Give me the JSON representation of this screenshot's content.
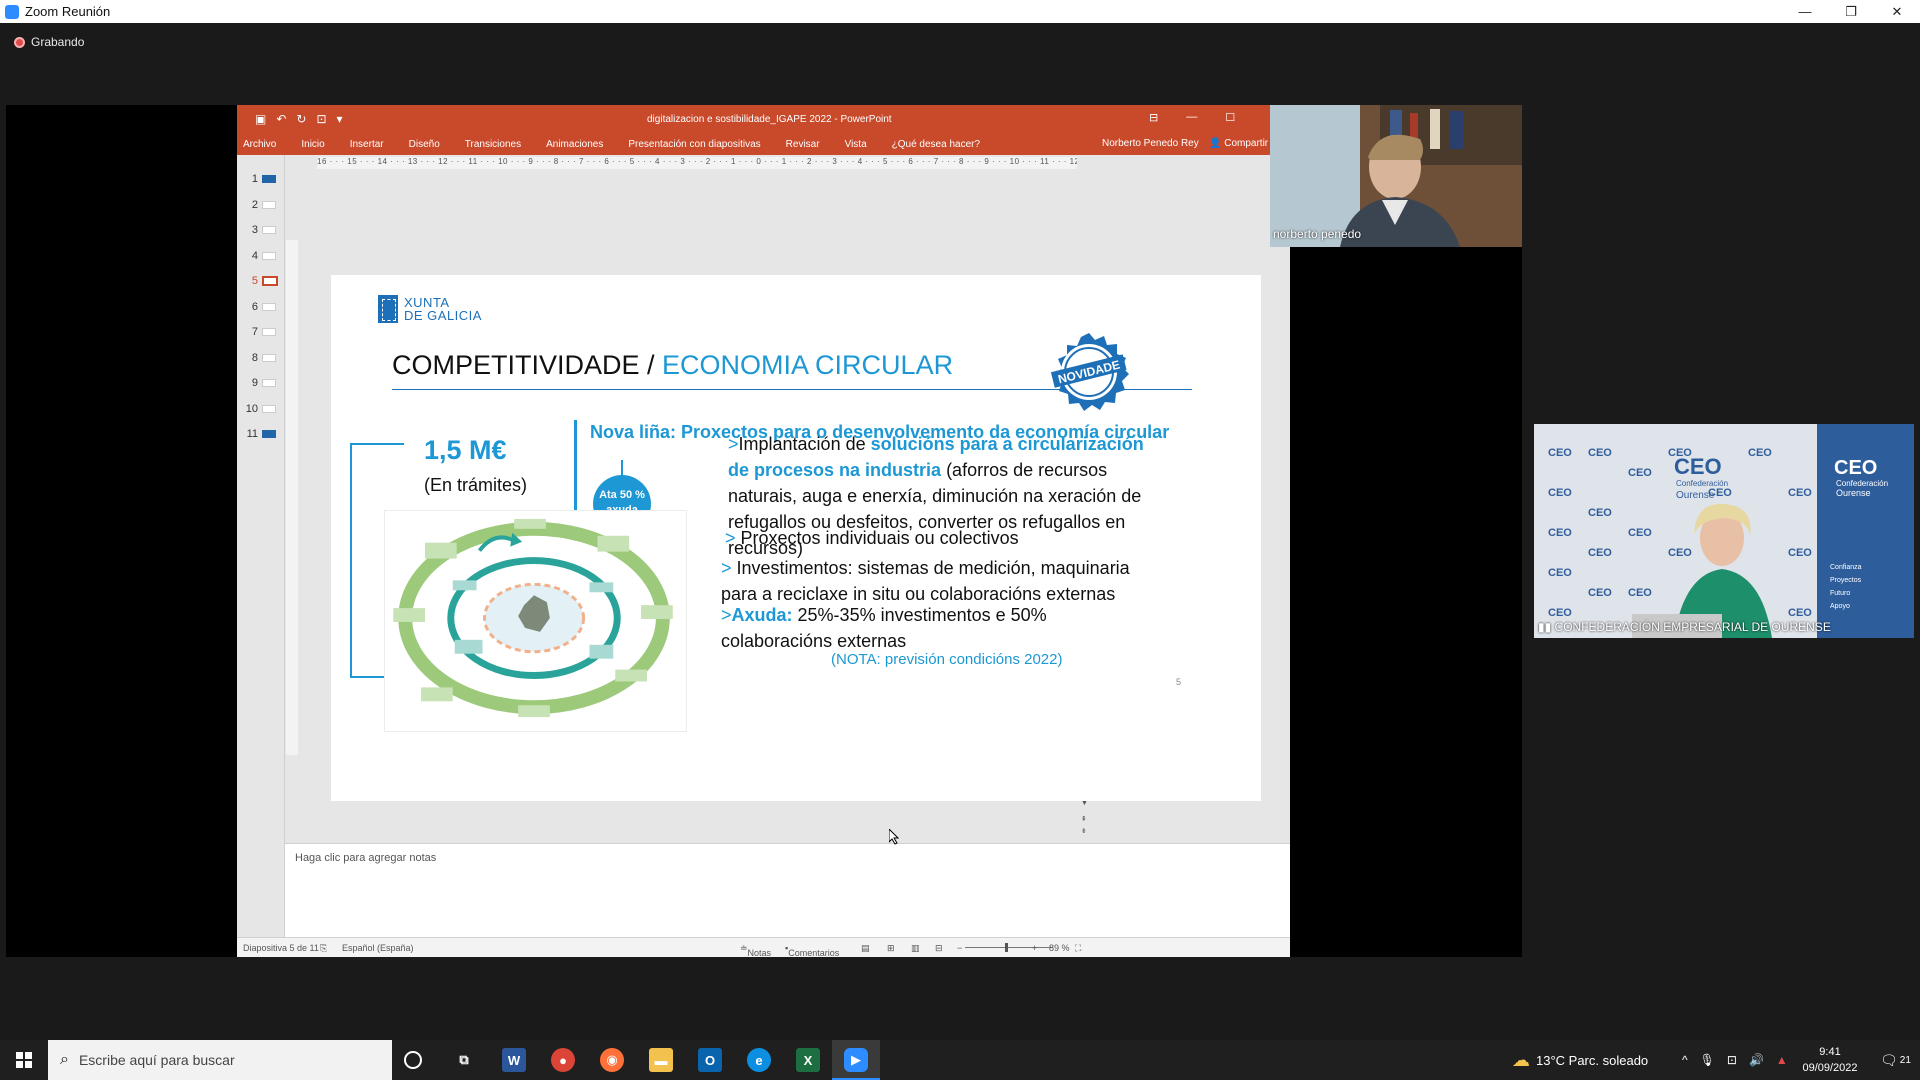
{
  "zoom": {
    "window_title": "Zoom Reunión",
    "recording_label": "Grabando",
    "window_controls": {
      "minimize": "—",
      "restore": "❐",
      "close": "✕"
    }
  },
  "powerpoint": {
    "doc_title": "digitalizacion e sostibilidade_IGAPE 2022 - PowerPoint",
    "ribbon_tabs": [
      "Archivo",
      "Inicio",
      "Insertar",
      "Diseño",
      "Transiciones",
      "Animaciones",
      "Presentación con diapositivas",
      "Revisar",
      "Vista",
      "¿Qué desea hacer?"
    ],
    "user": "Norberto Penedo Rey",
    "share": "Compartir",
    "ruler_text": "16 · · · 15 · · · 14 · · · 13 · · · 12 · · · 11 · · · 10 · · · 9 · · · 8 · · · 7 · · · 6 · · · 5 · · · 4 · · · 3 · · · 2 · · · 1 · · · 0 · · · 1 · · · 2 · · · 3 · · · 4 · · · 5 · · · 6 · · · 7 · · · 8 · · · 9 · · · 10 · · · 11 · · · 12 · · · 13 · · · 14 · · · 15 · · · 16",
    "thumbnails": [
      "1",
      "2",
      "3",
      "4",
      "5",
      "6",
      "7",
      "8",
      "9",
      "10",
      "11"
    ],
    "active_slide": 5,
    "notes_placeholder": "Haga clic para agregar notas",
    "status": {
      "slide_counter": "Diapositiva 5 de 11",
      "language": "Español (España)",
      "notes": "Notas",
      "comments": "Comentarios",
      "zoom": "89 %"
    }
  },
  "slide": {
    "logo_line1": "XUNTA",
    "logo_line2": "DE GALICIA",
    "title_main": "COMPETITIVIDADE / ",
    "title_highlight": "ECONOMIA CIRCULAR",
    "badge": "NOVIDADE",
    "amount": "1,5 M€",
    "amount_note": "(En trámites)",
    "subhead": "Nova liña: Proxectos para o desenvolvemento da economía circular",
    "aid_badge_line1": "Ata 50 %",
    "aid_badge_line2": "axuda",
    "bullet1_prefix": ">",
    "bullet1_a": "Implantación de ",
    "bullet1_hl": "solucións para a circularización de procesos na industria",
    "bullet1_b": " (aforros de recursos naturais, auga e enerxía, diminución na xeración de refugallos ou desfeitos, converter os refugallos en recursos)",
    "bullet2_prefix": ">",
    "bullet2": " Proxectos individuais ou colectivos",
    "bullet3_prefix": ">",
    "bullet3": " Investimentos: sistemas de medición, maquinaria para a reciclaxe in situ ou colaboracións externas",
    "bullet4_prefix": ">",
    "bullet4_hl": "Axuda:",
    "bullet4": " 25%-35% investimentos e 50% colaboracións externas",
    "nota": "(NOTA: previsión condicións 2022)",
    "page_number": "5"
  },
  "participants": {
    "speaker_name": "norberto penedo",
    "org_name": "CONFEDERACIÓN EMPRESARIAL DE OURENSE",
    "org_logo": "CEO",
    "org_logo_sub1": "Confederación",
    "org_logo_sub2": "Ourense",
    "backdrop_words": [
      "Confianza",
      "Proyectos",
      "Futuro",
      "Apoyo"
    ]
  },
  "taskbar": {
    "search_placeholder": "Escribe aquí para buscar",
    "weather": "13°C  Parc. soleado",
    "time": "9:41",
    "date": "09/09/2022",
    "notifications": "21",
    "colors": {
      "word": "#2b579a",
      "chrome": "#db4437",
      "firefox": "#ff7139",
      "explorer": "#f2c14e",
      "outlook": "#0a64ad",
      "edge": "#0c8fe0",
      "excel": "#1d6f42",
      "zoom": "#2d8cff"
    }
  },
  "colors": {
    "ppt_accent": "#c9492b",
    "slide_blue": "#1d98d4",
    "slide_navy": "#1d6fb7"
  }
}
